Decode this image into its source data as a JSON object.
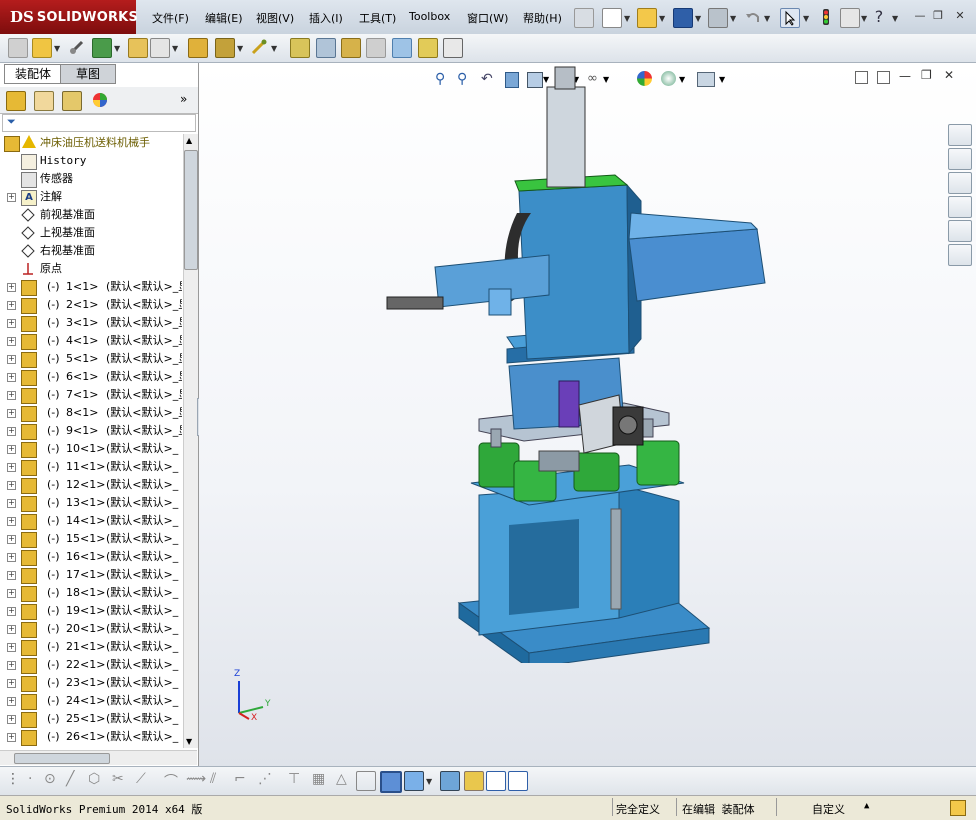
{
  "app": {
    "logo_prefix": "DS",
    "logo_name": "SOLIDWORKS"
  },
  "menu": [
    "文件(F)",
    "编辑(E)",
    "视图(V)",
    "插入(I)",
    "工具(T)",
    "Toolbox",
    "窗口(W)",
    "帮助(H)"
  ],
  "window_controls": {
    "minimize": "—",
    "restore": "❐",
    "close": "✕"
  },
  "panel_tabs": {
    "assembly": "装配体",
    "sketch": "草图"
  },
  "tree": {
    "root": "冲床油压机送料机械手",
    "items": [
      {
        "icon": "history-icon",
        "label": "History",
        "expandable": false
      },
      {
        "icon": "sensor-icon",
        "label": "传感器",
        "expandable": false
      },
      {
        "icon": "annotation-icon",
        "label": "注解",
        "expandable": true
      },
      {
        "icon": "plane-icon",
        "label": "前视基准面",
        "expandable": false
      },
      {
        "icon": "plane-icon",
        "label": "上视基准面",
        "expandable": false
      },
      {
        "icon": "plane-icon",
        "label": "右视基准面",
        "expandable": false
      },
      {
        "icon": "origin-icon",
        "label": "原点",
        "expandable": false
      }
    ],
    "components": [
      {
        "state": "(-)",
        "name": "1<1>",
        "config": "(默认<默认>_显"
      },
      {
        "state": "(-)",
        "name": "2<1>",
        "config": "(默认<默认>_显"
      },
      {
        "state": "(-)",
        "name": "3<1>",
        "config": "(默认<默认>_显"
      },
      {
        "state": "(-)",
        "name": "4<1>",
        "config": "(默认<默认>_显"
      },
      {
        "state": "(-)",
        "name": "5<1>",
        "config": "(默认<默认>_显"
      },
      {
        "state": "(-)",
        "name": "6<1>",
        "config": "(默认<默认>_显"
      },
      {
        "state": "(-)",
        "name": "7<1>",
        "config": "(默认<默认>_显"
      },
      {
        "state": "(-)",
        "name": "8<1>",
        "config": "(默认<默认>_显"
      },
      {
        "state": "(-)",
        "name": "9<1>",
        "config": "(默认<默认>_显"
      },
      {
        "state": "(-)",
        "name": "10<1>",
        "config": "(默认<默认>_"
      },
      {
        "state": "(-)",
        "name": "11<1>",
        "config": "(默认<默认>_"
      },
      {
        "state": "(-)",
        "name": "12<1>",
        "config": "(默认<默认>_"
      },
      {
        "state": "(-)",
        "name": "13<1>",
        "config": "(默认<默认>_"
      },
      {
        "state": "(-)",
        "name": "14<1>",
        "config": "(默认<默认>_"
      },
      {
        "state": "(-)",
        "name": "15<1>",
        "config": "(默认<默认>_"
      },
      {
        "state": "(-)",
        "name": "16<1>",
        "config": "(默认<默认>_"
      },
      {
        "state": "(-)",
        "name": "17<1>",
        "config": "(默认<默认>_"
      },
      {
        "state": "(-)",
        "name": "18<1>",
        "config": "(默认<默认>_"
      },
      {
        "state": "(-)",
        "name": "19<1>",
        "config": "(默认<默认>_"
      },
      {
        "state": "(-)",
        "name": "20<1>",
        "config": "(默认<默认>_"
      },
      {
        "state": "(-)",
        "name": "21<1>",
        "config": "(默认<默认>_"
      },
      {
        "state": "(-)",
        "name": "22<1>",
        "config": "(默认<默认>_"
      },
      {
        "state": "(-)",
        "name": "23<1>",
        "config": "(默认<默认>_"
      },
      {
        "state": "(-)",
        "name": "24<1>",
        "config": "(默认<默认>_"
      },
      {
        "state": "(-)",
        "name": "25<1>",
        "config": "(默认<默认>_"
      },
      {
        "state": "(-)",
        "name": "26<1>",
        "config": "(默认<默认>_"
      }
    ]
  },
  "triad": {
    "z": "Z",
    "y": "Y",
    "x": "X"
  },
  "status": {
    "product": "SolidWorks Premium 2014 x64 版",
    "definition": "完全定义",
    "mode": "在编辑 装配体",
    "units": "自定义",
    "units_arrow": "▲"
  },
  "colors": {
    "accent_red": "#9b1515",
    "model_blue": "#2b7fb8",
    "model_green": "#2fa83a",
    "selection": "#cfe3f7"
  }
}
